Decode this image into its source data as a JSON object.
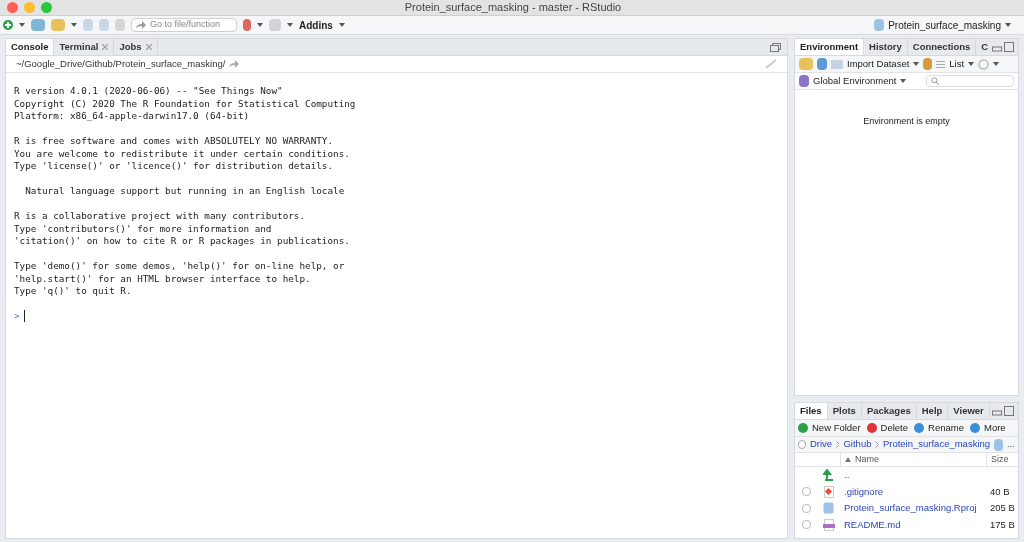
{
  "window": {
    "title": "Protein_surface_masking - master - RStudio"
  },
  "toolbar": {
    "goto_placeholder": "Go to file/function",
    "addins": "Addins",
    "project": "Protein_surface_masking"
  },
  "console_pane": {
    "tabs": [
      {
        "label": "Console",
        "selected": true,
        "closable": false
      },
      {
        "label": "Terminal",
        "selected": false,
        "closable": true
      },
      {
        "label": "Jobs",
        "selected": false,
        "closable": true
      }
    ],
    "path": "~/Google_Drive/Github/Protein_surface_masking/",
    "paragraphs": [
      [
        "R version 4.0.1 (2020-06-06) -- \"See Things Now\"",
        "Copyright (C) 2020 The R Foundation for Statistical Computing",
        "Platform: x86_64-apple-darwin17.0 (64-bit)"
      ],
      [
        "R is free software and comes with ABSOLUTELY NO WARRANTY.",
        "You are welcome to redistribute it under certain conditions.",
        "Type 'license()' or 'licence()' for distribution details."
      ],
      [
        "  Natural language support but running in an English locale"
      ],
      [
        "R is a collaborative project with many contributors.",
        "Type 'contributors()' for more information and",
        "'citation()' on how to cite R or R packages in publications."
      ],
      [
        "Type 'demo()' for some demos, 'help()' for on-line help, or",
        "'help.start()' for an HTML browser interface to help.",
        "Type 'q()' to quit R."
      ]
    ],
    "prompt": ">"
  },
  "env_pane": {
    "tabs": [
      {
        "label": "Environment",
        "selected": true
      },
      {
        "label": "History",
        "selected": false
      },
      {
        "label": "Connections",
        "selected": false
      },
      {
        "label": "C",
        "selected": false
      }
    ],
    "import": "Import Dataset",
    "list": "List",
    "scope": "Global Environment",
    "empty": "Environment is empty"
  },
  "files_pane": {
    "tabs": [
      {
        "label": "Files",
        "selected": true
      },
      {
        "label": "Plots",
        "selected": false
      },
      {
        "label": "Packages",
        "selected": false
      },
      {
        "label": "Help",
        "selected": false
      },
      {
        "label": "Viewer",
        "selected": false
      }
    ],
    "actions": [
      "New Folder",
      "Delete",
      "Rename",
      "More"
    ],
    "select_all": {
      "checked": false
    },
    "crumbs": [
      "Drive",
      "Github",
      "Protein_surface_masking"
    ],
    "more": "...",
    "columns": [
      "Name",
      "Size"
    ],
    "rows": [
      {
        "kind": "parent",
        "name": ".."
      },
      {
        "kind": "git",
        "name": ".gitignore",
        "size": "40 B",
        "checked": false
      },
      {
        "kind": "rproj",
        "name": "Protein_surface_masking.Rproj",
        "size": "205 B",
        "checked": false
      },
      {
        "kind": "md",
        "name": "README.md",
        "size": "175 B",
        "checked": false
      }
    ]
  }
}
